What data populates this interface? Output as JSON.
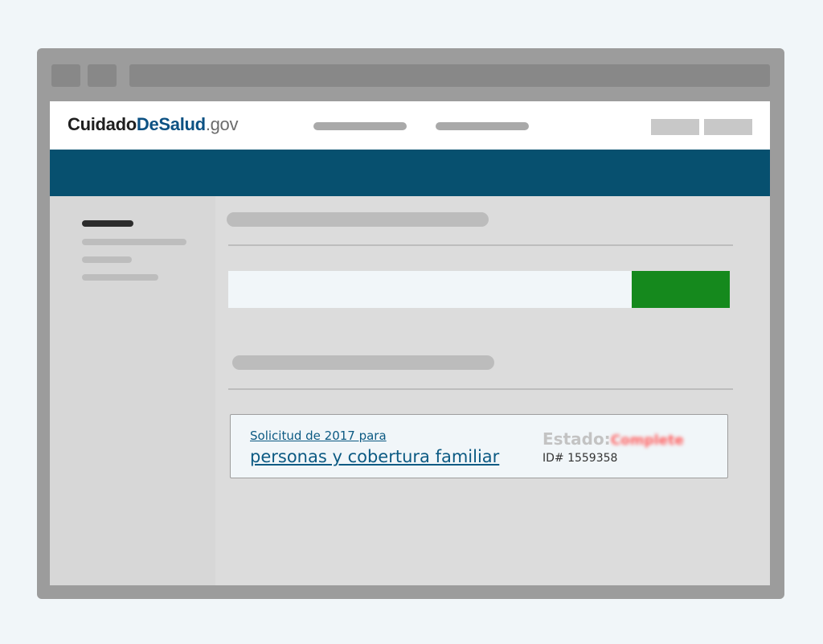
{
  "header": {
    "logo": {
      "part1": "Cuidado",
      "part2": "DeSalud",
      "part3": ".gov"
    }
  },
  "application_card": {
    "subtitle": "Solicitud de 2017 para",
    "title": "personas y cobertura familiar",
    "status_label": "Estado:",
    "status_value": "Complete",
    "id_text": "ID# 1559358"
  },
  "colors": {
    "page_background": "#f1f6f9",
    "brand_blue": "#07506f",
    "link_blue": "#0c5a83",
    "action_green": "#15891d",
    "status_red": "#ff5f5f"
  }
}
